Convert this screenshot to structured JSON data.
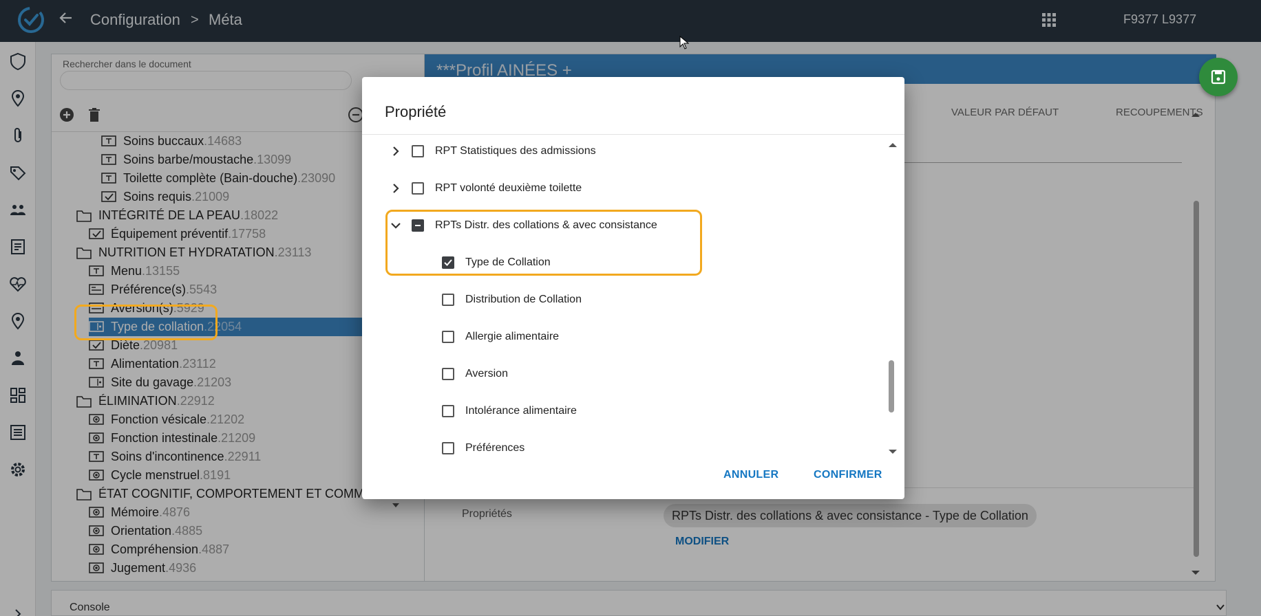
{
  "topbar": {
    "breadcrumb_root": "Configuration",
    "breadcrumb_sep": ">",
    "breadcrumb_current": "Méta",
    "user_code": "F9377 L9377"
  },
  "search": {
    "label": "Rechercher dans le document",
    "value": ""
  },
  "tree": {
    "items": [
      {
        "label": "Soins buccaux",
        "id": ".14683",
        "icon": "text-field-icon"
      },
      {
        "label": "Soins barbe/moustache",
        "id": ".13099",
        "icon": "text-field-icon"
      },
      {
        "label": "Toilette complète (Bain-douche)",
        "id": ".23090",
        "icon": "text-field-icon"
      },
      {
        "label": "Soins requis",
        "id": ".21009",
        "icon": "checkbox-field-icon"
      },
      {
        "label": "INTÉGRITÉ DE LA PEAU",
        "id": ".18022",
        "icon": "folder-icon"
      },
      {
        "label": "Équipement préventif",
        "id": ".17758",
        "icon": "checkbox-field-icon"
      },
      {
        "label": "NUTRITION ET HYDRATATION",
        "id": ".23113",
        "icon": "folder-icon"
      },
      {
        "label": "Menu",
        "id": ".13155",
        "icon": "text-field-icon"
      },
      {
        "label": "Préférence(s)",
        "id": ".5543",
        "icon": "textarea-field-icon"
      },
      {
        "label": "Aversion(s)",
        "id": ".5929",
        "icon": "textarea-field-icon"
      },
      {
        "label": "Type de collation",
        "id": ".22054",
        "icon": "select-field-icon"
      },
      {
        "label": "Diète",
        "id": ".20981",
        "icon": "checkbox-field-icon"
      },
      {
        "label": "Alimentation",
        "id": ".23112",
        "icon": "text-field-icon"
      },
      {
        "label": "Site du gavage",
        "id": ".21203",
        "icon": "select-field-icon"
      },
      {
        "label": "ÉLIMINATION",
        "id": ".22912",
        "icon": "folder-icon"
      },
      {
        "label": "Fonction vésicale",
        "id": ".21202",
        "icon": "radio-field-icon"
      },
      {
        "label": "Fonction intestinale",
        "id": ".21209",
        "icon": "radio-field-icon"
      },
      {
        "label": "Soins d'incontinence",
        "id": ".22911",
        "icon": "text-field-icon"
      },
      {
        "label": "Cycle menstruel",
        "id": ".8191",
        "icon": "radio-field-icon"
      },
      {
        "label": "ÉTAT COGNITIF, COMPORTEMENT ET COMM...",
        "id": "",
        "icon": "folder-icon"
      },
      {
        "label": "Mémoire",
        "id": ".4876",
        "icon": "radio-field-icon"
      },
      {
        "label": "Orientation",
        "id": ".4885",
        "icon": "radio-field-icon"
      },
      {
        "label": "Compréhension",
        "id": ".4887",
        "icon": "radio-field-icon"
      },
      {
        "label": "Jugement",
        "id": ".4936",
        "icon": "radio-field-icon"
      }
    ]
  },
  "profile": {
    "title": "***Profil AINÉES +",
    "col_default": "VALEUR PAR DÉFAUT",
    "col_overlap": "RECOUPEMENTS",
    "properties_label": "Propriétés",
    "properties_chip": "RPTs Distr. des collations & avec consistance - Type de Collation",
    "modify_label": "MODIFIER"
  },
  "console": {
    "label": "Console"
  },
  "dialog": {
    "title": "Propriété",
    "rows": [
      {
        "label": "RPT Statistiques des admissions",
        "state": "unchecked",
        "expandable": "collapsed"
      },
      {
        "label": "RPT volonté deuxième toilette",
        "state": "unchecked",
        "expandable": "collapsed"
      },
      {
        "label": "RPTs Distr. des collations & avec consistance",
        "state": "indeterminate",
        "expandable": "expanded"
      },
      {
        "label": "Type de Collation",
        "state": "checked",
        "expandable": "none"
      },
      {
        "label": "Distribution de Collation",
        "state": "unchecked",
        "expandable": "none"
      },
      {
        "label": "Allergie alimentaire",
        "state": "unchecked",
        "expandable": "none"
      },
      {
        "label": "Aversion",
        "state": "unchecked",
        "expandable": "none"
      },
      {
        "label": "Intolérance alimentaire",
        "state": "unchecked",
        "expandable": "none"
      },
      {
        "label": "Préférences",
        "state": "unchecked",
        "expandable": "none"
      }
    ],
    "cancel_label": "ANNULER",
    "confirm_label": "CONFIRMER"
  },
  "colors": {
    "topbar": "#2a3541",
    "accent": "#3b86c4",
    "highlight": "#f2a91f",
    "action": "#1577c2",
    "save": "#2f8b3c"
  }
}
